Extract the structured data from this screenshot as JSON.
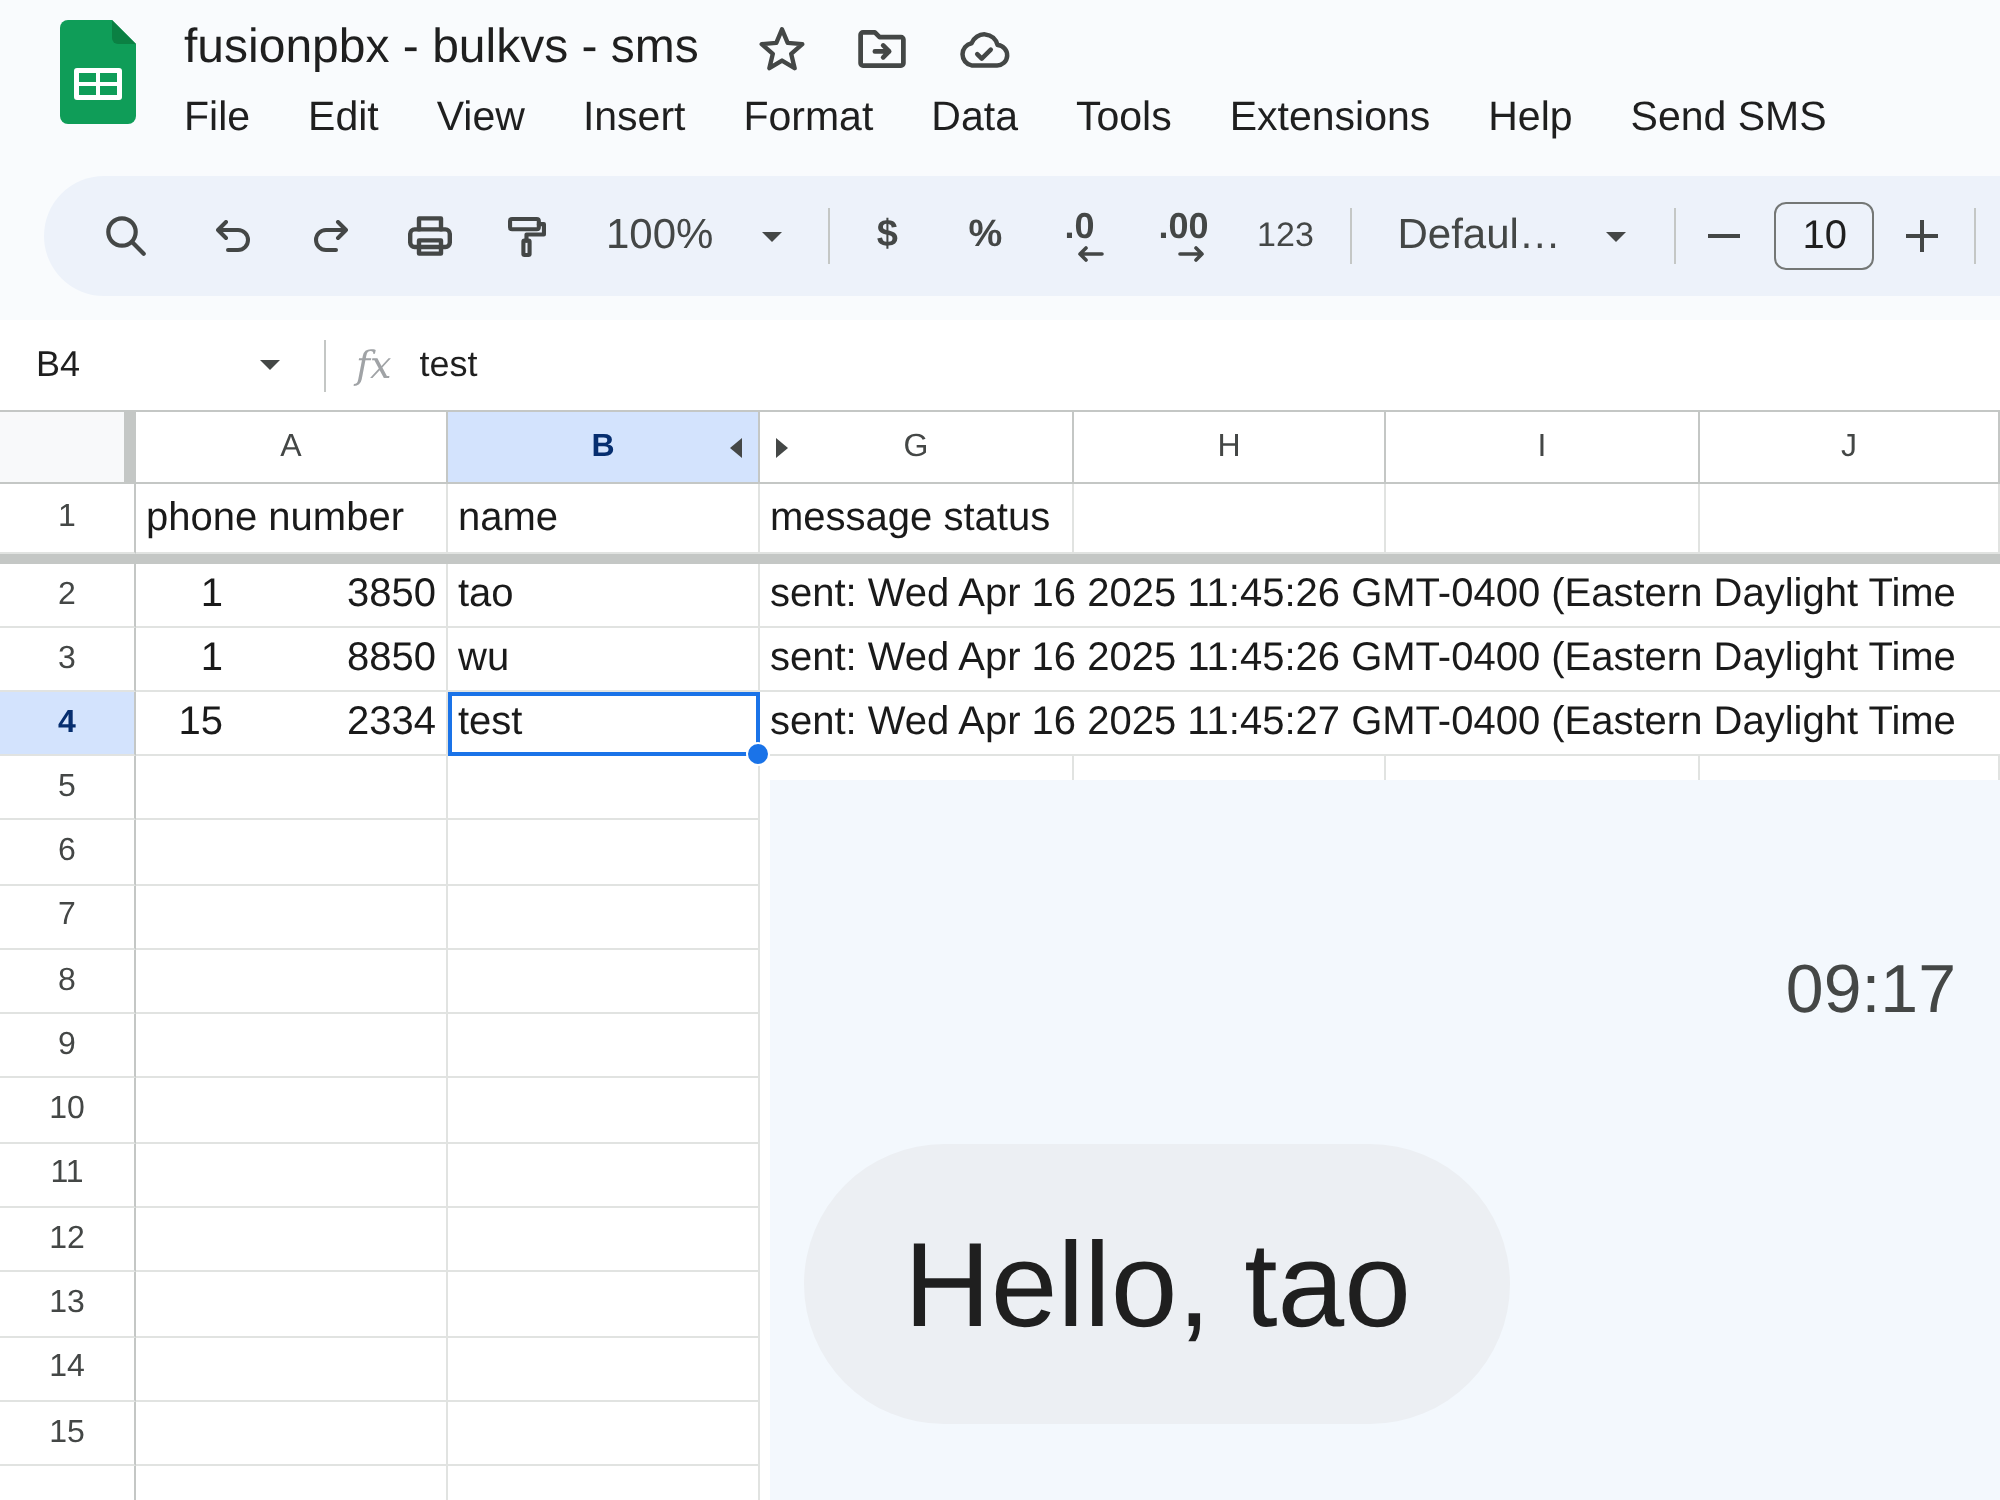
{
  "document": {
    "title": "fusionpbx - bulkvs - sms"
  },
  "menu": [
    "File",
    "Edit",
    "View",
    "Insert",
    "Format",
    "Data",
    "Tools",
    "Extensions",
    "Help",
    "Send SMS"
  ],
  "toolbar": {
    "zoom": "100%",
    "currency": "$",
    "percent": "%",
    "decrease_decimal": ".0",
    "increase_decimal": ".00",
    "number_format": "123",
    "font": "Defaul…",
    "font_size": "10"
  },
  "formula_bar": {
    "cell": "B4",
    "fx_label": "fx",
    "value": "test"
  },
  "sheet": {
    "columns": [
      {
        "label": "A",
        "selected": false,
        "hidden_after": false
      },
      {
        "label": "B",
        "selected": true,
        "hidden_after": true
      },
      {
        "label": "G",
        "selected": false,
        "hidden_after": false
      },
      {
        "label": "H",
        "selected": false,
        "hidden_after": false
      },
      {
        "label": "I",
        "selected": false,
        "hidden_after": false
      },
      {
        "label": "J",
        "selected": false,
        "hidden_after": false
      }
    ],
    "header_row": {
      "number": "1",
      "cells": [
        "phone number",
        "name",
        "message status"
      ]
    },
    "rows": [
      {
        "number": "2",
        "selected": false,
        "phone": {
          "start": "1",
          "end": "3850"
        },
        "name": "tao",
        "status": "sent: Wed Apr 16 2025 11:45:26 GMT-0400 (Eastern Daylight Time"
      },
      {
        "number": "3",
        "selected": false,
        "phone": {
          "start": "1",
          "end": "8850"
        },
        "name": "wu",
        "status": "sent: Wed Apr 16 2025 11:45:26 GMT-0400 (Eastern Daylight Time"
      },
      {
        "number": "4",
        "selected": true,
        "phone": {
          "start": "15",
          "end": "2334"
        },
        "name": "test",
        "status": "sent: Wed Apr 16 2025 11:45:27 GMT-0400 (Eastern Daylight Time"
      }
    ],
    "empty_rows": [
      "5",
      "6",
      "7",
      "8",
      "9",
      "10",
      "11",
      "12",
      "13",
      "14",
      "15"
    ]
  },
  "sms_preview": {
    "time": "09:17",
    "message": "Hello, tao"
  }
}
